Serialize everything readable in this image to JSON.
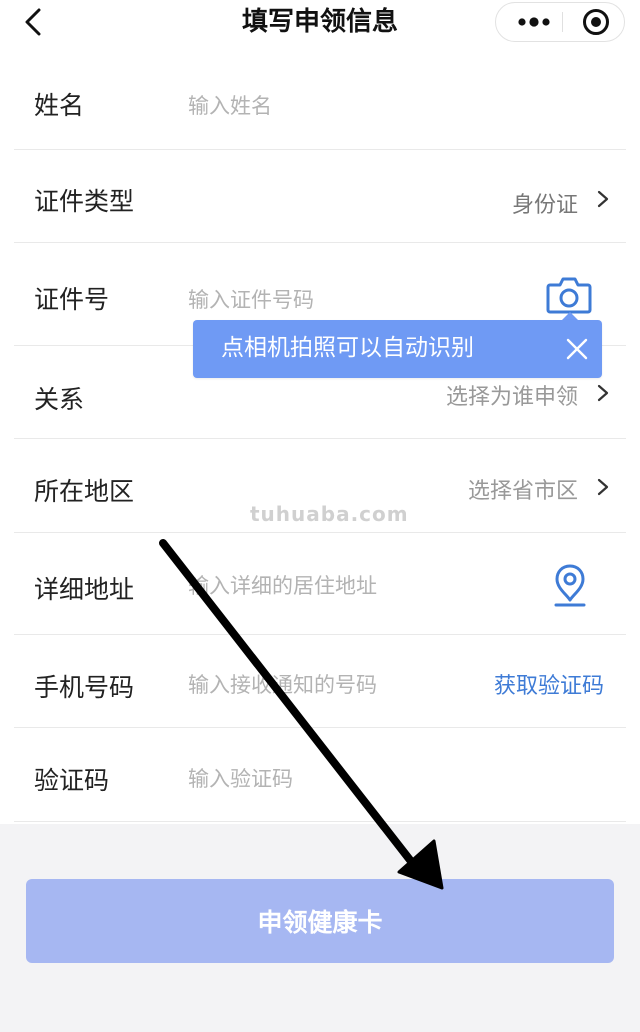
{
  "header": {
    "title": "填写申领信息"
  },
  "form": {
    "name": {
      "label": "姓名",
      "placeholder": "输入姓名"
    },
    "id_type": {
      "label": "证件类型",
      "value": "身份证"
    },
    "id_number": {
      "label": "证件号",
      "placeholder": "输入证件号码"
    },
    "relation": {
      "label": "关系",
      "value": "选择为谁申领"
    },
    "region": {
      "label": "所在地区",
      "value": "选择省市区"
    },
    "address": {
      "label": "详细地址",
      "placeholder": "输入详细的居住地址"
    },
    "phone": {
      "label": "手机号码",
      "placeholder": "输入接收通知的号码",
      "action": "获取验证码"
    },
    "code": {
      "label": "验证码",
      "placeholder": "输入验证码"
    }
  },
  "tooltip": {
    "text": "点相机拍照可以自动识别"
  },
  "watermark": "tuhuaba.com",
  "submit": {
    "label": "申领健康卡"
  },
  "colors": {
    "accent": "#4a90e2",
    "tooltip_bg": "#6f9af4",
    "button_bg": "#a6b7f2",
    "link": "#3e7bd6"
  }
}
